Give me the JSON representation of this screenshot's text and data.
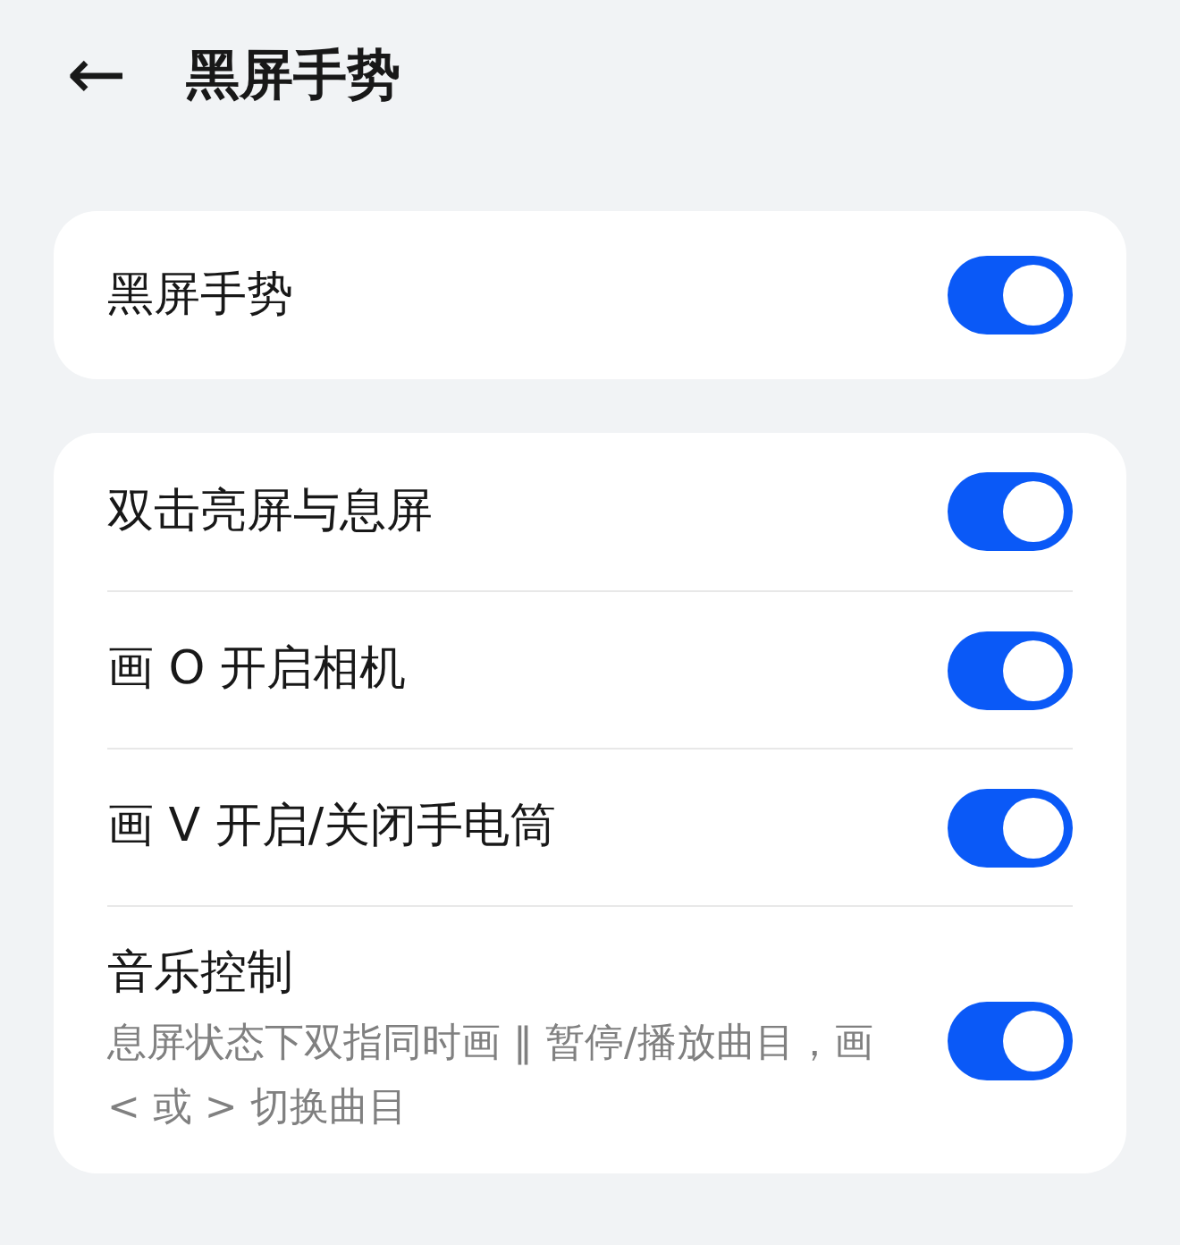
{
  "header": {
    "back": "←",
    "title": "黑屏手势"
  },
  "main_card": {
    "label": "黑屏手势",
    "on": true
  },
  "gestures": [
    {
      "label": "双击亮屏与息屏",
      "on": true
    },
    {
      "label": "画 O 开启相机",
      "on": true
    },
    {
      "label": "画 V 开启/关闭手电筒",
      "on": true
    },
    {
      "label": "音乐控制",
      "description": "息屏状态下双指同时画 ‖ 暂停/播放曲目，画 < 或 > 切换曲目",
      "on": true
    }
  ]
}
